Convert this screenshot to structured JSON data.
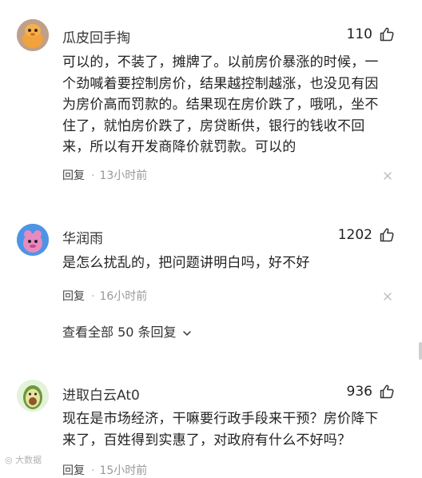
{
  "comments": [
    {
      "username": "瓜皮回手掏",
      "likes": "110",
      "text": "可以的，不装了，摊牌了。以前房价暴涨的时候，一个劲喊着要控制房价，结果越控制越涨，也没见有因为房价高而罚款的。结果现在房价跌了，哦吼，坐不住了，就怕房价跌了，房贷断供，银行的钱收不回来，所以有开发商降价就罚款。可以的",
      "reply_label": "回复",
      "separator": "·",
      "time": "13小时前",
      "avatar_icon": "orange-cartoon-avatar-icon",
      "avatar_bg": "#c0a28a"
    },
    {
      "username": "华润雨",
      "likes": "1202",
      "text": "是怎么扰乱的，把问题讲明白吗，好不好",
      "reply_label": "回复",
      "separator": "·",
      "time": "16小时前",
      "avatar_icon": "pink-cartoon-avatar-icon",
      "avatar_bg": "#4a8fe0"
    },
    {
      "username": "进取白云At0",
      "likes": "936",
      "text": "现在是市场经济，干嘛要行政手段来干预？房价降下来了，百姓得到实惠了，对政府有什么不好吗？",
      "reply_label": "回复",
      "separator": "·",
      "time": "15小时前",
      "avatar_icon": "avocado-avatar-icon",
      "avatar_bg": "#dff0d4"
    }
  ],
  "view_all_replies": "查看全部 50 条回复",
  "watermark": "大数据",
  "colors": {
    "text": "#222222",
    "muted": "#999999",
    "background": "#ffffff"
  }
}
